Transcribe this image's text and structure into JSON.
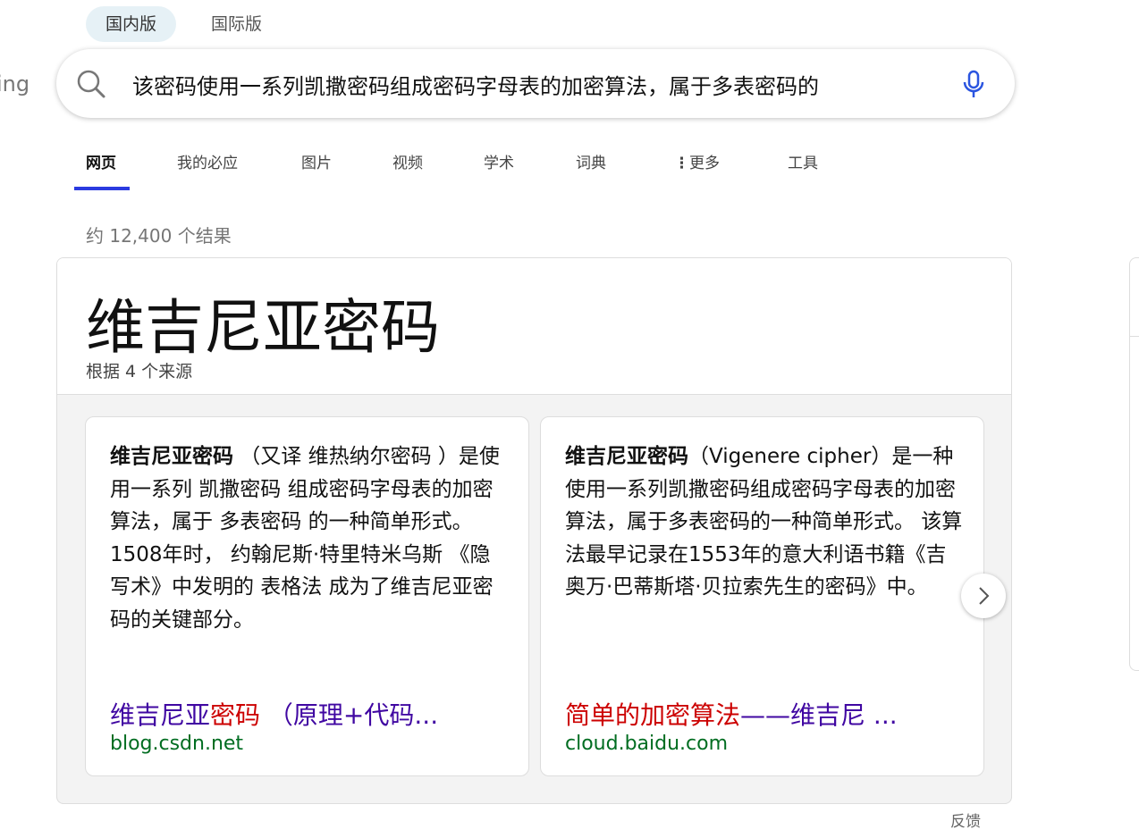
{
  "versions": [
    "国内版",
    "国际版"
  ],
  "logo_fragment": "ing",
  "search": {
    "query": "该密码使用一系列凯撒密码组成密码字母表的加密算法，属于多表密码的"
  },
  "tabs": [
    "网页",
    "我的必应",
    "图片",
    "视频",
    "学术",
    "词典",
    "更多",
    "工具"
  ],
  "result_count": "约 12,400 个结果",
  "answer": {
    "title": "维吉尼亚密码",
    "sources": "根据 4 个来源",
    "cards": [
      {
        "bold": "维吉尼亚密码",
        "text": " （又译 维热纳尔密码 ）是使用一系列 凯撒密码 组成密码字母表的加密算法，属于 多表密码 的一种简单形式。 1508年时， 约翰尼斯·特里特米乌斯 《隐写术》中发明的 表格法 成为了维吉尼亚密码的关键部分。",
        "link_parts": [
          {
            "t": "维吉尼亚",
            "hl": false
          },
          {
            "t": "密码",
            "hl": true
          },
          {
            "t": " （原理+代码...",
            "hl": false
          }
        ],
        "domain": "blog.csdn.net"
      },
      {
        "bold": "维吉尼亚密码",
        "text": "（Vigenere cipher）是一种使用一系列凯撒密码组成密码字母表的加密算法，属于多表密码的一种简单形式。 该算法最早记录在1553年的意大利语书籍《吉奥万·巴蒂斯塔·贝拉索先生的密码》中。",
        "link_parts": [
          {
            "t": "简单的加密算法",
            "hl": true
          },
          {
            "t": "——维吉尼 ...",
            "hl": false
          }
        ],
        "domain": "cloud.baidu.com"
      }
    ]
  },
  "feedback": "反馈",
  "colors": {
    "accent": "#2b3be0",
    "link": "#4007a2",
    "highlight": "#cc0000",
    "domain": "#006d21"
  }
}
